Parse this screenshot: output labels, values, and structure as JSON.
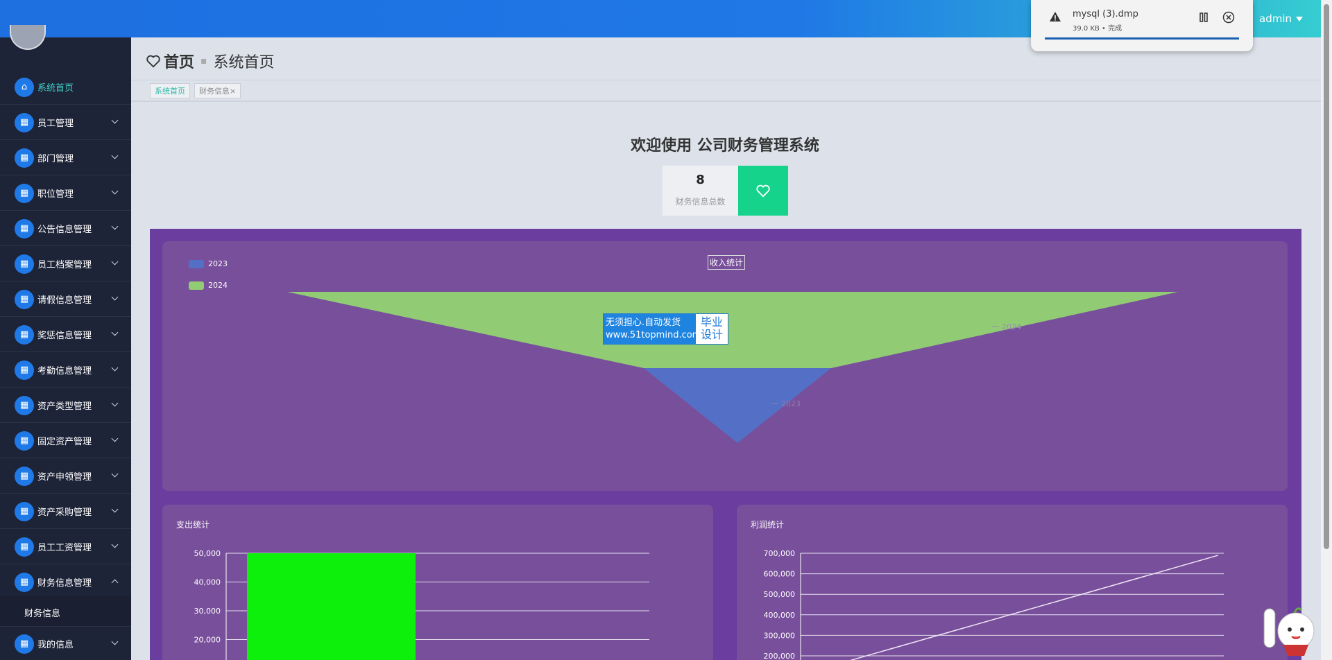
{
  "header": {
    "user": "admin"
  },
  "download": {
    "filename": "mysql (3).dmp",
    "meta": "39.0 KB • 完成"
  },
  "sidebar": {
    "items": [
      {
        "label": "系统首页",
        "icon": "home-icon"
      },
      {
        "label": "员工管理",
        "icon": "grid-icon"
      },
      {
        "label": "部门管理",
        "icon": "ticket-icon"
      },
      {
        "label": "职位管理",
        "icon": "grid-icon"
      },
      {
        "label": "公告信息管理",
        "icon": "grid-icon"
      },
      {
        "label": "员工档案管理",
        "icon": "chart-icon"
      },
      {
        "label": "请假信息管理",
        "icon": "list-icon"
      },
      {
        "label": "奖惩信息管理",
        "icon": "grid-icon"
      },
      {
        "label": "考勤信息管理",
        "icon": "grid-icon"
      },
      {
        "label": "资产类型管理",
        "icon": "grid-icon"
      },
      {
        "label": "固定资产管理",
        "icon": "grid-icon"
      },
      {
        "label": "资产申领管理",
        "icon": "bar-chart-icon"
      },
      {
        "label": "资产采购管理",
        "icon": "building-icon"
      },
      {
        "label": "员工工资管理",
        "icon": "sliders-icon"
      },
      {
        "label": "财务信息管理",
        "icon": "send-icon"
      },
      {
        "label": "我的信息",
        "icon": "card-icon"
      }
    ],
    "sub_item": "财务信息"
  },
  "page": {
    "title_bold": "首页",
    "title_sub": "系统首页"
  },
  "tabs": [
    {
      "label": "系统首页"
    },
    {
      "label": "财务信息×"
    }
  ],
  "welcome": "欢迎使用 公司财务管理系统",
  "stat": {
    "value": "8",
    "caption": "财务信息总数"
  },
  "ad": {
    "line1": "无须担心.自动发货",
    "line2": "www.51topmind.com",
    "right1": "毕业",
    "right2": "设计"
  },
  "colors": {
    "accent": "#1f7ae8",
    "teal": "#3fd0c4",
    "green": "#16d38b",
    "panel": "#6a3d9e"
  },
  "chart_data": [
    {
      "type": "funnel",
      "title": "收入统计",
      "categories": [
        "2023",
        "2024"
      ],
      "series": [
        {
          "name": "2023",
          "color": "#5470c6"
        },
        {
          "name": "2024",
          "color": "#91cc75"
        }
      ],
      "labels": [
        "2023",
        "2024"
      ]
    },
    {
      "type": "bar",
      "title": "支出统计",
      "ytick_labels": [
        "50,000",
        "40,000",
        "30,000",
        "20,000"
      ],
      "ylim": [
        0,
        50000
      ],
      "values": [
        50000
      ],
      "color": "#0cf00c"
    },
    {
      "type": "line",
      "title": "利润统计",
      "ytick_labels": [
        "700,000",
        "600,000",
        "500,000",
        "400,000",
        "300,000",
        "200,000"
      ],
      "ylim": [
        200000,
        700000
      ],
      "series": [
        {
          "start": 150000,
          "end": 690000
        }
      ]
    }
  ]
}
